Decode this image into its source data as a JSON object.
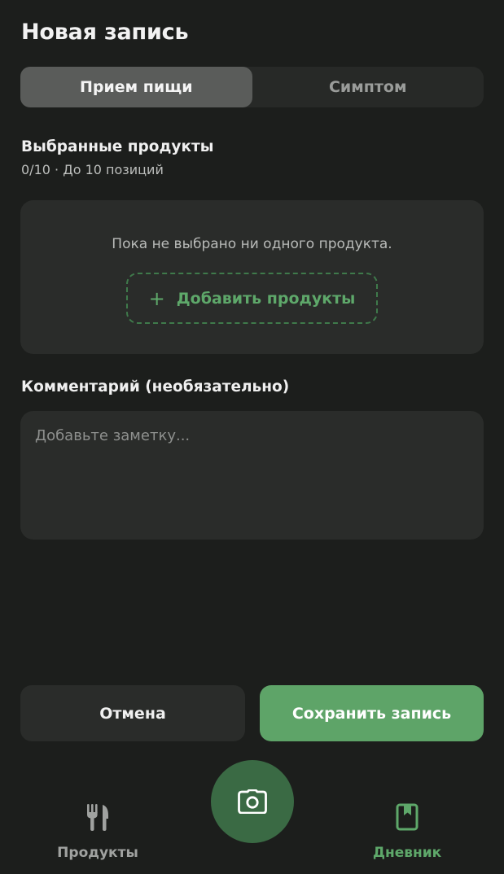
{
  "header": {
    "title": "Новая запись"
  },
  "tabs": [
    {
      "label": "Прием пищи",
      "active": true
    },
    {
      "label": "Симптом",
      "active": false
    }
  ],
  "products": {
    "title": "Выбранные продукты",
    "subtitle": "0/10 · До 10 позиций",
    "empty_text": "Пока не выбрано ни одного продукта.",
    "add_label": "Добавить продукты",
    "add_icon": "+"
  },
  "comment": {
    "title": "Комментарий (необязательно)",
    "placeholder": "Добавьте заметку...",
    "value": ""
  },
  "actions": {
    "cancel_label": "Отмена",
    "save_label": "Сохранить запись"
  },
  "nav": {
    "products_label": "Продукты",
    "diary_label": "Дневник",
    "products_icon": "fork-knife-icon",
    "camera_icon": "camera-icon",
    "diary_icon": "book-icon"
  },
  "colors": {
    "accent": "#5ea468",
    "background": "#1c1e1c",
    "card": "#2a2c2a"
  }
}
